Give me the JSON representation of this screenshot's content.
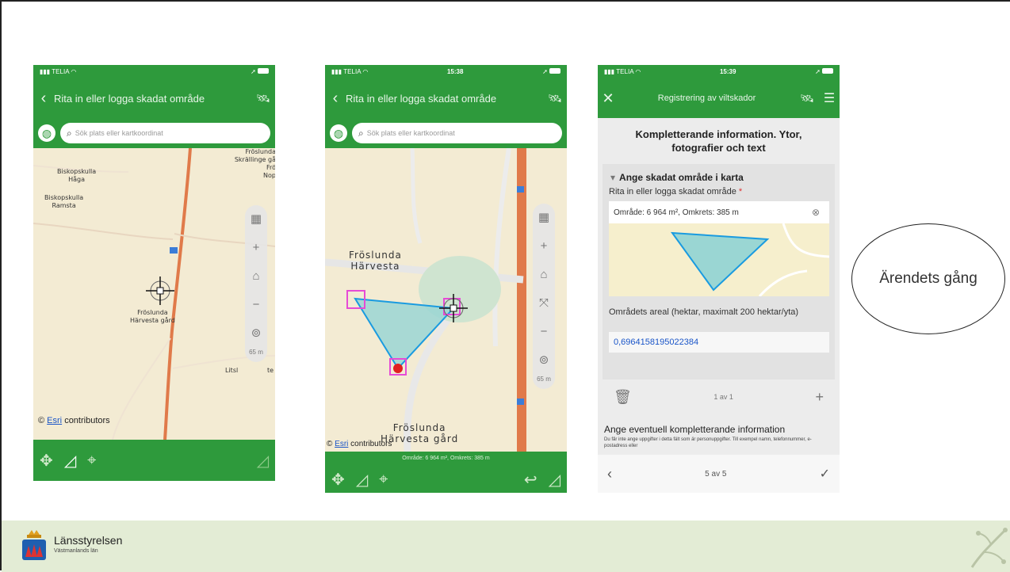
{
  "phone1": {
    "status": {
      "carrier": "TELIA"
    },
    "nav_title": "Rita in eller logga skadat område",
    "search_placeholder": "Sök plats eller kartkoordinat",
    "labels": [
      "Biskopskulla\nHåga",
      "Biskopskulla\nRamsta",
      "Fröslunda\nSkrällinge gå\nFrö\nNop",
      "Fröslunda\nHärvesta gård",
      "Litsl",
      "te"
    ],
    "scale": "65 m",
    "attribution_link": "Esri",
    "attribution_text": "contributors"
  },
  "phone2": {
    "status": {
      "carrier": "TELIA",
      "time": "15:38"
    },
    "nav_title": "Rita in eller logga skadat område",
    "search_placeholder": "Sök plats eller kartkoordinat",
    "labels": [
      "Fröslunda\nHärvesta",
      "Fröslunda\nHärvesta gård"
    ],
    "scale": "65 m",
    "attribution_link": "Esri",
    "attribution_text": "contributors",
    "area_readout": "Område: 6 964 m², Omkrets: 385 m"
  },
  "phone3": {
    "status": {
      "carrier": "TELIA",
      "time": "15:39"
    },
    "nav_title": "Registrering av viltskador",
    "heading": "Kompletterande information. Ytor, fotografier och text",
    "section_title": "Ange skadat område i karta",
    "field_label": "Rita in eller logga skadat område",
    "required_mark": "*",
    "area_summary": "Område: 6 964 m², Omkrets: 385 m",
    "areal_label": "Områdets areal (hektar, maximalt 200 hektar/yta)",
    "areal_value": "0,6964158195022384",
    "pager": "1 av 1",
    "extra_label": "Ange eventuell kompletterande information",
    "extra_hint": "Du får inte ange uppgifter i detta fält som är personuppgifter. Till exempel namn, telefonnummer, e-postadress eller",
    "page_indicator": "5 av 5"
  },
  "sidenote": "Ärendets gång",
  "footer": {
    "org": "Länsstyrelsen",
    "region": "Västmanlands län"
  },
  "colors": {
    "brand_green": "#2e9a3c",
    "polygon_fill": "#9ad6d3",
    "polygon_stroke": "#1a9be0",
    "vertex": "#e64bd6"
  }
}
